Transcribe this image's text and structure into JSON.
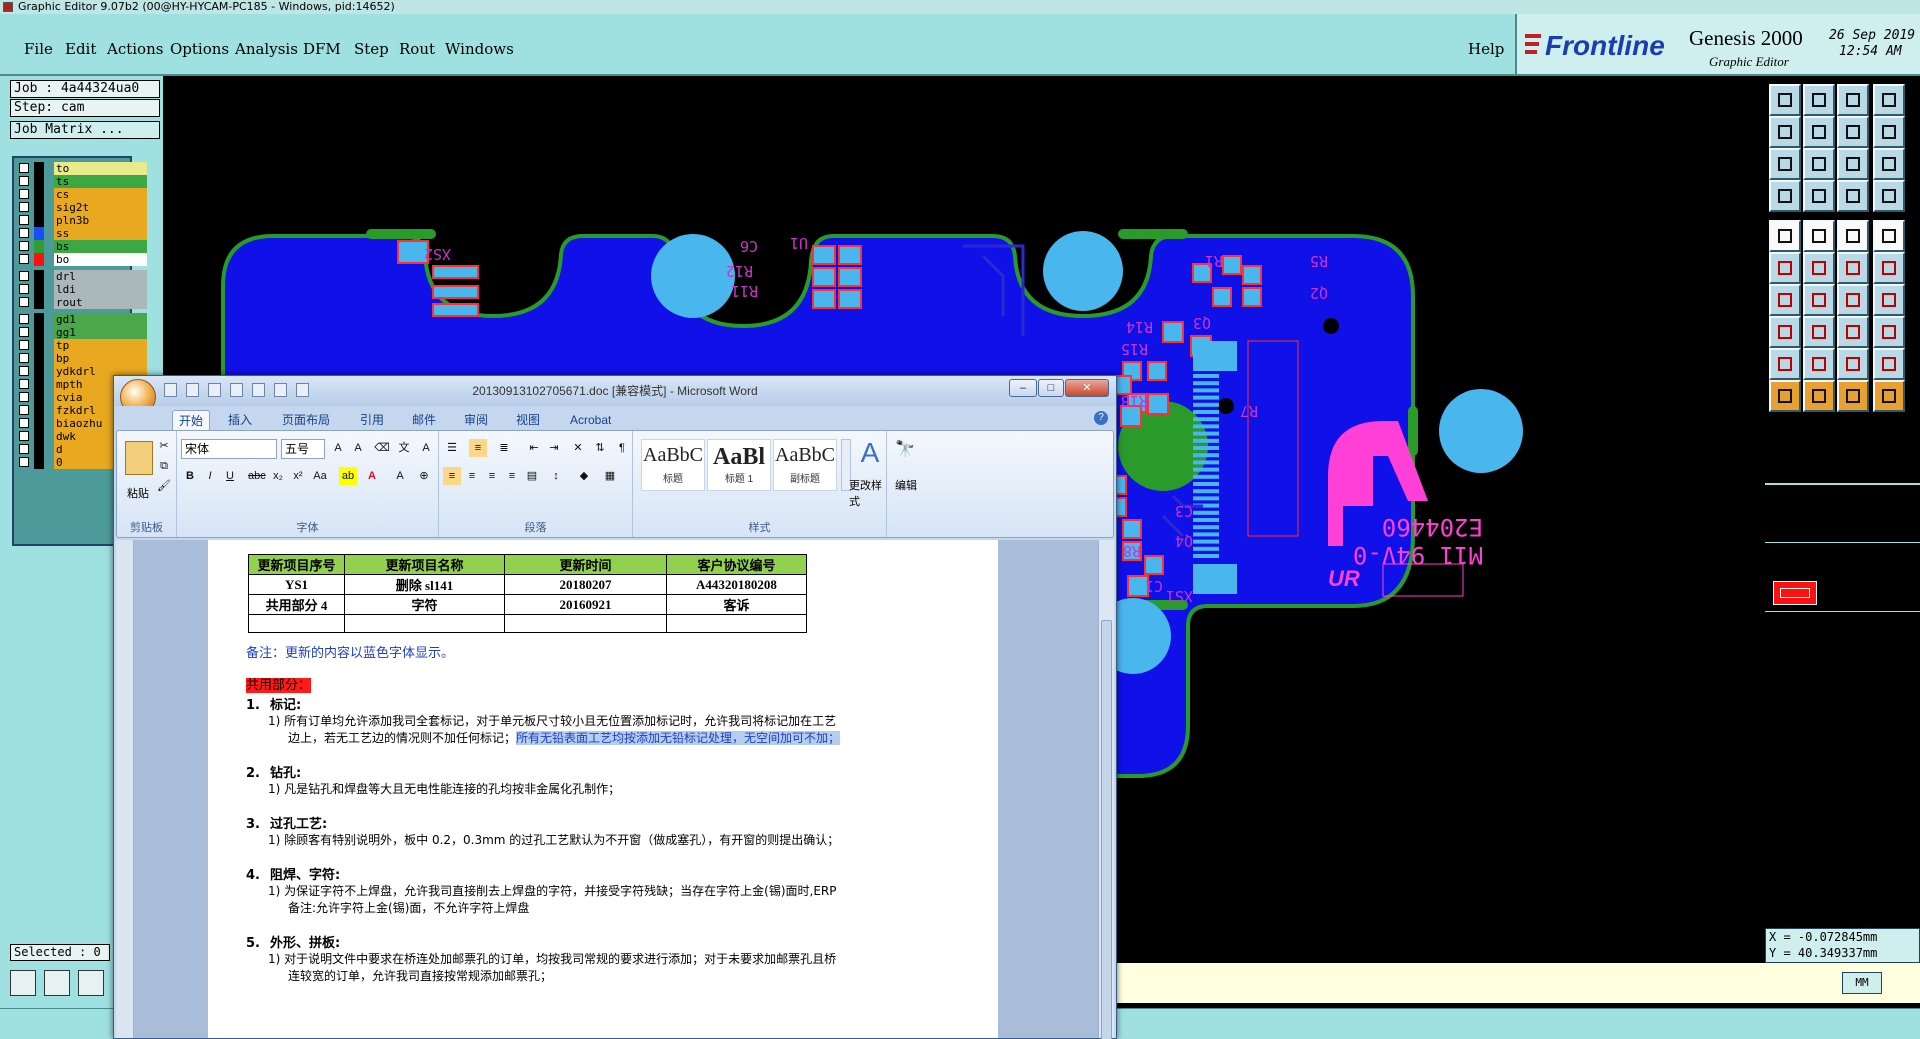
{
  "app": {
    "title": "Graphic Editor 9.07b2 (00@HY-HYCAM-PC185 - Windows, pid:14652)",
    "menu": [
      "File",
      "Edit",
      "Actions",
      "Options",
      "Analysis",
      "DFM",
      "Step",
      "Rout",
      "Windows"
    ],
    "help": "Help",
    "brand": "Frontline",
    "product": "Genesis 2000",
    "product_sub": "Graphic Editor",
    "date": "26 Sep 2019",
    "time": "12:54 AM"
  },
  "info": {
    "job": "Job : 4a44324ua0",
    "step": "Step: cam",
    "matrix": "Job Matrix ..."
  },
  "layers": [
    {
      "name": "to",
      "color": "#000000",
      "bg": "#e9ea8c"
    },
    {
      "name": "ts",
      "color": "#000000",
      "bg": "#3ba844"
    },
    {
      "name": "cs",
      "color": "#000000",
      "bg": "#e8a820"
    },
    {
      "name": "sig2t",
      "color": "#000000",
      "bg": "#e8a820"
    },
    {
      "name": "pln3b",
      "color": "#000000",
      "bg": "#e8a820"
    },
    {
      "name": "ss",
      "color": "#1a4cff",
      "bg": "#e8a820"
    },
    {
      "name": "bs",
      "color": "#2fa02f",
      "bg": "#3ba844"
    },
    {
      "name": "bo",
      "color": "#ff1010",
      "bg": "#ffffff"
    },
    {
      "name": "drl",
      "color": "#000000",
      "bg": "#aab8bc"
    },
    {
      "name": "ldi",
      "color": "#000000",
      "bg": "#aab8bc"
    },
    {
      "name": "rout",
      "color": "#000000",
      "bg": "#aab8bc"
    },
    {
      "name": "gd1",
      "color": "#000000",
      "bg": "#4aa84a"
    },
    {
      "name": "gg1",
      "color": "#000000",
      "bg": "#4aa84a"
    },
    {
      "name": "tp",
      "color": "#000000",
      "bg": "#e8a820"
    },
    {
      "name": "bp",
      "color": "#000000",
      "bg": "#e8a820"
    },
    {
      "name": "ydkdrl",
      "color": "#000000",
      "bg": "#e8a820"
    },
    {
      "name": "mpth",
      "color": "#000000",
      "bg": "#e8a820"
    },
    {
      "name": "cvia",
      "color": "#000000",
      "bg": "#e8a820"
    },
    {
      "name": "fzkdrl",
      "color": "#000000",
      "bg": "#e8a820"
    },
    {
      "name": "biaozhu",
      "color": "#000000",
      "bg": "#e8a820"
    },
    {
      "name": "dwk",
      "color": "#000000",
      "bg": "#e8a820"
    },
    {
      "name": "d",
      "color": "#000000",
      "bg": "#e8a820"
    },
    {
      "name": "0",
      "color": "#000000",
      "bg": "#e8a820"
    }
  ],
  "selected": "Selected : 0",
  "coords": {
    "x": "X = -0.072845mm",
    "y": "Y = 40.349337mm"
  },
  "units": "MM",
  "pcb_text": {
    "silk1": "E204460",
    "silk2": "M11 94V-0",
    "logo": "UR",
    "refs": [
      "XS2",
      "C6",
      "U1",
      "R12",
      "R11",
      "R5",
      "R1",
      "Q2",
      "Q3",
      "R14",
      "R15",
      "R18",
      "R7",
      "R8",
      "C3",
      "C1",
      "Q4",
      "XS1"
    ]
  },
  "word": {
    "title": "20130913102705671.doc [兼容模式] - Microsoft Word",
    "tabs": [
      "开始",
      "插入",
      "页面布局",
      "引用",
      "邮件",
      "审阅",
      "视图",
      "Acrobat"
    ],
    "font": "宋体",
    "size": "五号",
    "groups": [
      "剪贴板",
      "字体",
      "段落",
      "样式",
      "编辑"
    ],
    "paste": "粘贴",
    "styles": [
      {
        "preview": "AaBbC",
        "name": "标题"
      },
      {
        "preview": "AaBl",
        "name": "标题 1"
      },
      {
        "preview": "AaBbC",
        "name": "副标题"
      }
    ],
    "change_style": "更改样式",
    "edit": "编辑",
    "table_headers": [
      "更新项目序号",
      "更新项目名称",
      "更新时间",
      "客户协议编号"
    ],
    "table_rows": [
      [
        "YS1",
        "删除 sl141",
        "20180207",
        "A44320180208"
      ],
      [
        "共用部分 4",
        "字符",
        "20160921",
        "客诉"
      ],
      [
        "",
        "",
        "",
        ""
      ]
    ],
    "note": "备注：更新的内容以蓝色字体显示。",
    "section": "共用部分：",
    "items": [
      {
        "num": "1.",
        "title": "标记:",
        "lines": [
          "1) 所有订单均允许添加我司全套标记，对于单元板尺寸较小且无位置添加标记时，允许我司将标记加在工艺",
          "边上，若无工艺边的情况则不加任何标记；"
        ],
        "selected": "所有无铅表面工艺均按添加无铅标记处理，无空间加可不加；"
      },
      {
        "num": "2.",
        "title": "钻孔:",
        "lines": [
          "1) 凡是钻孔和焊盘等大且无电性能连接的孔均按非金属化孔制作；"
        ]
      },
      {
        "num": "3.",
        "title": "过孔工艺:",
        "lines": [
          "1) 除顾客有特别说明外，板中 0.2，0.3mm 的过孔工艺默认为不开窗（做成塞孔），有开窗的则提出确认；"
        ]
      },
      {
        "num": "4.",
        "title": "阻焊、字符:",
        "lines": [
          "1) 为保证字符不上焊盘，允许我司直接削去上焊盘的字符，并接受字符残缺；当存在字符上金(锡)面时,ERP",
          "备注:允许字符上金(锡)面，不允许字符上焊盘"
        ]
      },
      {
        "num": "5.",
        "title": "外形、拼板:",
        "lines": [
          "1) 对于说明文件中要求在桥连处加邮票孔的订单，均按我司常规的要求进行添加；对于未要求加邮票孔且桥",
          "连较宽的订单，允许我司直接按常规添加邮票孔；"
        ]
      }
    ]
  }
}
